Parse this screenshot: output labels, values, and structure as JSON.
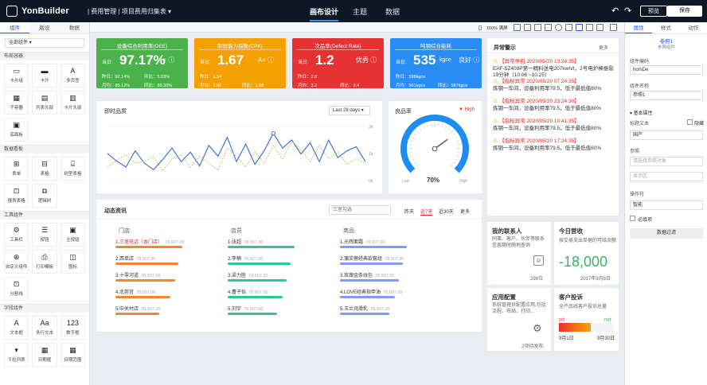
{
  "topbar": {
    "brand": "YonBuilder",
    "crumb": "| 费用管理 | 项目费用归集表 ▾",
    "menu": [
      "画布设计",
      "主题",
      "数据"
    ],
    "preview": "预览",
    "save": "保存",
    "zoom": "100% 满屏"
  },
  "left": {
    "tabs": [
      "组件",
      "版设",
      "数据"
    ],
    "select": "全部组件 ▾",
    "groups": [
      {
        "title": "布局容器",
        "items": [
          {
            "icon": "▭",
            "label": "卡片组"
          },
          {
            "icon": "▬",
            "label": "卡片"
          },
          {
            "icon": "A",
            "label": "多页签"
          },
          {
            "icon": "▦",
            "label": "子容器"
          },
          {
            "icon": "▤",
            "label": "列表头部"
          },
          {
            "icon": "▥",
            "label": "卡片头部"
          },
          {
            "icon": "▣",
            "label": "底面板"
          }
        ]
      },
      {
        "title": "数据看板",
        "items": [
          {
            "icon": "⊞",
            "label": "表单"
          },
          {
            "icon": "⊟",
            "label": "表格"
          },
          {
            "icon": "⌸",
            "label": "树型表格"
          },
          {
            "icon": "⊡",
            "label": "报表表格"
          },
          {
            "icon": "⧉",
            "label": "逻辑树"
          }
        ]
      },
      {
        "title": "工具组件",
        "items": [
          {
            "icon": "⚙",
            "label": "工具栏"
          },
          {
            "icon": "☰",
            "label": "按钮"
          },
          {
            "icon": "▣",
            "label": "主按钮"
          },
          {
            "icon": "⊕",
            "label": "自定义组件"
          },
          {
            "icon": "⎙",
            "label": "打印模板"
          },
          {
            "icon": "◫",
            "label": "图标"
          },
          {
            "icon": "⊡",
            "label": "分割线"
          }
        ]
      },
      {
        "title": "字段组件",
        "items": [
          {
            "icon": "A",
            "label": "文本框"
          },
          {
            "icon": "Aa",
            "label": "多行文本"
          },
          {
            "icon": "123",
            "label": "数字框"
          },
          {
            "icon": "▾",
            "label": "下拉列表"
          },
          {
            "icon": "▦",
            "label": "日期框"
          },
          {
            "icon": "▦",
            "label": "日期范围"
          }
        ]
      }
    ]
  },
  "kpis": [
    {
      "title": "设备综合利用率(OEE)",
      "label": "当日:",
      "value": "97.17%",
      "trend": "↑ ⓘ",
      "color": "#4bb14a",
      "s": [
        "昨日：92.14%",
        "环比：5.03%",
        "月均：85.12%",
        "同比：89.30%"
      ]
    },
    {
      "title": "制程能力指数(CPK)",
      "label": "当日:",
      "value": "1.67",
      "trend": "A+ ⓘ",
      "color": "#f4a000",
      "s": [
        "昨日：1.54",
        "",
        "月均：1.60",
        "同比：1.68"
      ]
    },
    {
      "title": "次品率(Defect Rate)",
      "label": "当日:",
      "value": "1.2",
      "trend": "优秀 ⓘ",
      "color": "#e63232",
      "s": [
        "昨日：2.8",
        "",
        "月均：3.2",
        "同比：3.4"
      ]
    },
    {
      "title": "吨钢综合能耗",
      "label": "当日:",
      "value": "535",
      "unit": "kgce",
      "trend": "良好 ⓘ",
      "color": "#2a8cf5",
      "s": [
        "昨日：598kgce",
        "",
        "月均：561kgce",
        "同比：587kgce"
      ]
    }
  ],
  "quality": {
    "title": "即时品质",
    "range": "Last 28 days ▾",
    "yticks": [
      "2k",
      "1k",
      "0k"
    ]
  },
  "chart_data": {
    "type": "line",
    "title": "即时品质",
    "yticks": [
      "2k",
      "1k",
      "0k"
    ],
    "ylim": [
      0,
      2000
    ],
    "series": [
      {
        "values": [
          1000,
          720,
          500,
          1100,
          650,
          400,
          780,
          1200,
          700,
          1050,
          540,
          1300,
          900,
          1600,
          700,
          1350,
          600,
          1100,
          1750,
          1200,
          1500,
          980,
          1400,
          700,
          1500,
          850,
          1100,
          1250,
          700
        ]
      },
      {
        "values": [
          500,
          750,
          950,
          650,
          700,
          900,
          350,
          800,
          950,
          500,
          900,
          650,
          380,
          1200,
          900,
          500,
          1050,
          650,
          1300,
          800,
          1450,
          1150,
          700,
          1300,
          800,
          1050,
          600,
          800,
          650
        ]
      }
    ]
  },
  "gauge": {
    "title": "良品率",
    "flag": "▼ High",
    "value": "70%",
    "value_num": 70,
    "low": "Low",
    "high": "High"
  },
  "alarms": {
    "title": "异常警示",
    "more": "更多",
    "items": [
      {
        "title": "【异常停机 2020/05/20 10:24:35】",
        "text": "EAF-5Z409P第一精料送电207kwh/t，2号电炉棒振裂19分钟（10:06 ~10:25）"
      },
      {
        "title": "【指标异常 2020/05/20 07:24:35】",
        "text": "炼钢一车间，设备利用率79.5，低于最低值80%"
      },
      {
        "title": "【指标异常 2020/05/20 23:24:30】",
        "text": "炼钢一车间，设备利用率79.5，低于最低值80%"
      },
      {
        "title": "【指标异常 2020/05/20 10:41:35】",
        "text": "炼钢一车间，设备利用率79.5，低于最低值80%"
      },
      {
        "title": "【指标异常 2020/05/20 17:24:35】",
        "text": "炼钢一车间，设备利用率79.5，低于最低值80%"
      }
    ]
  },
  "news": {
    "title": "动态资讯",
    "select": "三室勾选",
    "filters": [
      "昨天",
      "近7天",
      "近30天",
      "更多"
    ],
    "columns": [
      {
        "head": "门店",
        "color": "#f0843c",
        "rows": [
          {
            "n": "1.三室电话（本门店）",
            "v": "78,907.00",
            "w": 0.95,
            "hl": true
          },
          {
            "n": "2.西单店",
            "v": "78,907.00",
            "w": 0.9
          },
          {
            "n": "3.十零河道",
            "v": "78,907.00",
            "w": 0.85
          },
          {
            "n": "4.北苑宫",
            "v": "78,907.00",
            "w": 0.78
          },
          {
            "n": "5.中关村店",
            "v": "78,907.00",
            "w": 0.62
          }
        ]
      },
      {
        "head": "店员",
        "color": "#32c2a0",
        "rows": [
          {
            "n": "1.张超",
            "v": "78,907.00",
            "w": 0.95
          },
          {
            "n": "2.李楠",
            "v": "78,907.00",
            "w": 0.9
          },
          {
            "n": "3.梁力胜",
            "v": "78,907.00",
            "w": 0.84
          },
          {
            "n": "4.曹子怡",
            "v": "78,907.00",
            "w": 0.78
          },
          {
            "n": "5.刘宇",
            "v": "78,907.00",
            "w": 0.7
          }
        ]
      },
      {
        "head": "商品",
        "color": "#7f9ef2",
        "rows": [
          {
            "n": "1.光辉面霜",
            "v": "78,907.00",
            "w": 0.95
          },
          {
            "n": "2.蒲芙蓉经典款套组",
            "v": "78,907.00",
            "w": 0.9
          },
          {
            "n": "3.玫瑰金条纹包",
            "v": "78,907.00",
            "w": 0.84
          },
          {
            "n": "4.LOVE经典指甲油",
            "v": "78,907.00",
            "w": 0.78
          },
          {
            "n": "5.玉兰润滑乳",
            "v": "78,907.00",
            "w": 0.7
          }
        ]
      }
    ]
  },
  "contacts": {
    "title": "我的联系人",
    "text": "同事、客户、伙伴等联系信息随时随地查询",
    "count": "298位"
  },
  "income": {
    "title": "今日营收",
    "text": "按交易支出单据的可结余额",
    "value": "-18,000",
    "date": "2017年9月8日"
  },
  "appcfg": {
    "title": "应用配置",
    "text": "系统管理员配置应用,包括流程、布局、打印...",
    "count": "2项待发布"
  },
  "complaint": {
    "title": "客户投诉",
    "text": "全产品线客户投诉总量",
    "start": "0件",
    "end": "78件",
    "d1": "9月1日",
    "d2": "9月30日",
    "fill": 0.58
  },
  "right": {
    "tabs": [
      "属性",
      "样式",
      "动作"
    ],
    "sel_name": "参照1",
    "sel_sub": "参照组件",
    "f1_label": "组件编码",
    "f1_value": "homDe",
    "f2_label": "组件名称",
    "f2_value": "参照1",
    "section": "▾ 基本属性",
    "f3_label": "标题文本",
    "f3_check": "隐藏",
    "f3_value": "国产",
    "f4_label": "参照",
    "f4_placeholder": "请选择参照对象",
    "f4_sub": "显示区",
    "f5_label": "操作符",
    "f5_value": "智能",
    "required": "必填项",
    "btn": "数据过滤"
  }
}
